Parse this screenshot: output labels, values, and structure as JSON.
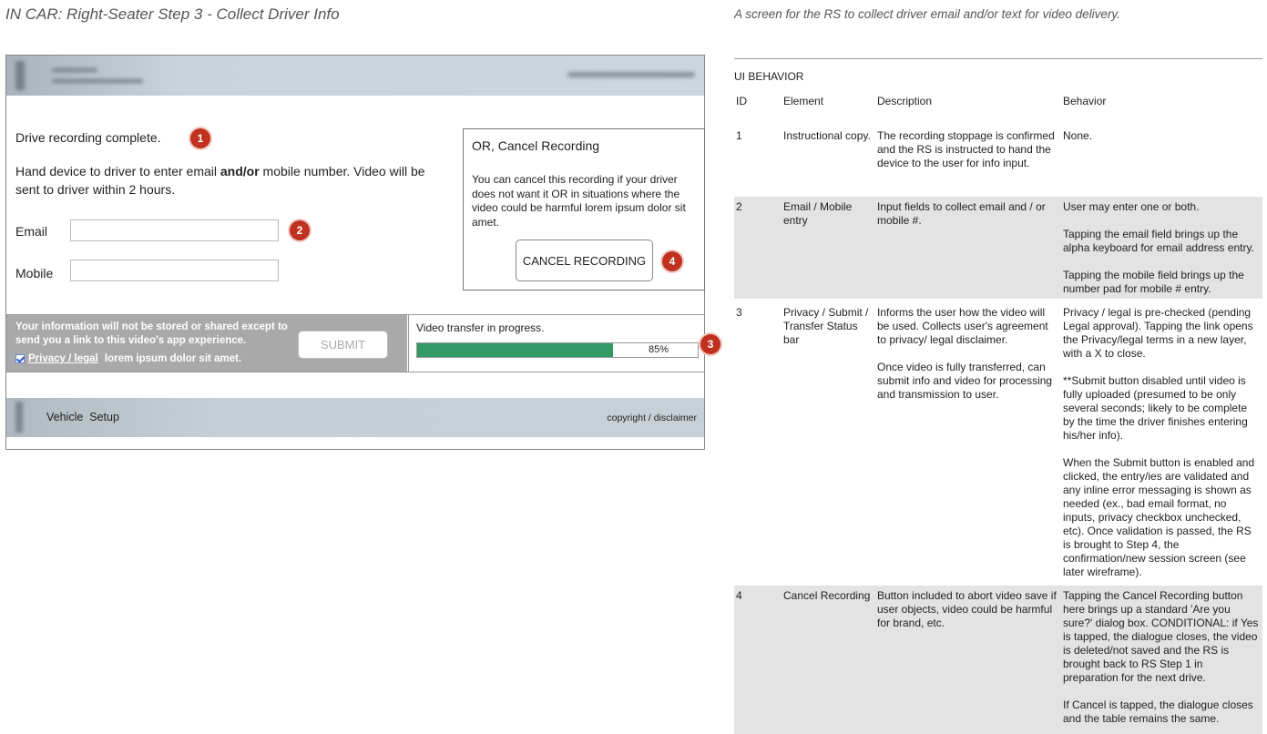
{
  "page": {
    "title": "IN CAR: Right-Seater Step 3 - Collect Driver Info",
    "subtitle": "A screen for the RS to collect driver email and/or text for video delivery."
  },
  "wireframe": {
    "instruction_complete": "Drive recording complete.",
    "instruction_hand_prefix": "Hand device to driver to enter email ",
    "instruction_hand_bold": "and/or",
    "instruction_hand_suffix": " mobile number. Video will be sent to driver within 2 hours.",
    "email_label": "Email",
    "email_value": "",
    "mobile_label": "Mobile",
    "mobile_value": "",
    "cancel_box": {
      "title": "OR, Cancel Recording",
      "body": "You can cancel this recording if your driver does not want it OR in situations where the video could be harmful lorem ipsum dolor sit amet.",
      "button_label": "CANCEL RECORDING"
    },
    "privacy": {
      "notice": "Your information will not be stored or shared except to send you a link to this video's app experience.",
      "checkbox_checked": true,
      "link_label": "Privacy / legal",
      "suffix": " lorem ipsum dolor sit amet."
    },
    "submit_label": "SUBMIT",
    "transfer": {
      "label": "Video transfer in progress.",
      "progress_percent": 85,
      "progress_text": "85%"
    },
    "footer": {
      "nav_label": "Vehicle  Setup",
      "copyright": "copyright / disclaimer"
    },
    "badges": [
      "1",
      "2",
      "3",
      "4"
    ],
    "colors": {
      "badge": "#c0311f",
      "progress": "#339966",
      "header": "#c9d3da",
      "privacy_panel": "#a9a9a9"
    }
  },
  "behavior": {
    "section_title": "UI BEHAVIOR",
    "headers": [
      "ID",
      "Element",
      "Description",
      "Behavior"
    ],
    "rows": [
      {
        "id": "1",
        "element": "Instructional copy.",
        "description": [
          "The recording stoppage is confirmed and the RS is instructed to hand the device to the user for info input."
        ],
        "behavior": [
          "None."
        ]
      },
      {
        "id": "2",
        "element": "Email / Mobile entry",
        "description": [
          "Input fields to collect email and / or mobile #."
        ],
        "behavior": [
          "User may enter one or both.",
          "Tapping the email field brings up the alpha keyboard for email address entry.",
          "Tapping the mobile field brings up the number pad for mobile # entry."
        ]
      },
      {
        "id": "3",
        "element": "Privacy / Submit / Transfer Status bar",
        "description": [
          "Informs the user how the video will be used.  Collects user's agreement to privacy/ legal disclaimer.",
          "Once video is fully transferred, can submit info and video for processing and transmission to user."
        ],
        "behavior": [
          "Privacy / legal is pre-checked (pending Legal approval).  Tapping the link opens the Privacy/legal terms in a new layer, with a X to close.",
          "**Submit button disabled until video is fully uploaded (presumed to be only several seconds; likely to be complete by the time the driver finishes entering his/her info).",
          "When the Submit button is enabled and clicked, the entry/ies are validated and any inline error messaging is shown as needed (ex., bad email format, no inputs, privacy checkbox unchecked, etc).  Once validation is passed, the RS is brought to Step 4, the confirmation/new session screen (see later wireframe)."
        ]
      },
      {
        "id": "4",
        "element": "Cancel Recording",
        "description": [
          "Button included to abort video save if user objects, video could be harmful for brand, etc."
        ],
        "behavior": [
          "Tapping the Cancel Recording button here brings up a standard 'Are you sure?' dialog box.  CONDITIONAL: if Yes is tapped, the dialogue closes, the video is deleted/not saved and the RS is brought back to RS Step 1 in preparation for the next drive.",
          "If Cancel is tapped, the dialogue closes and the table remains the same."
        ]
      }
    ]
  }
}
